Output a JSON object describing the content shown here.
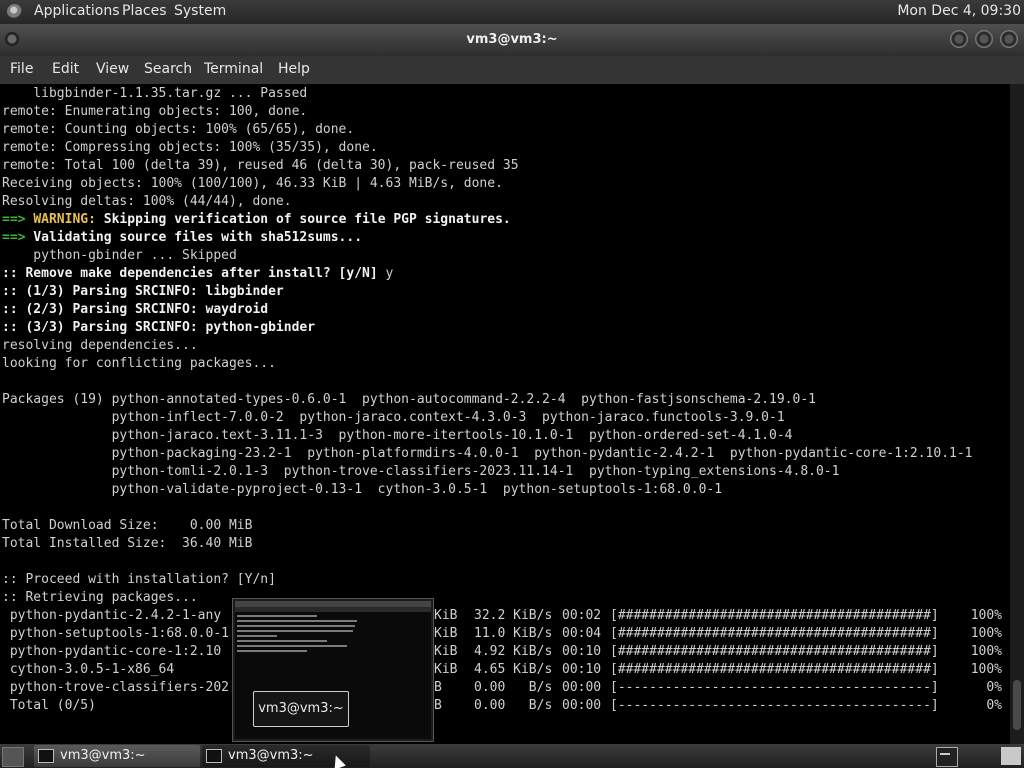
{
  "top_panel": {
    "menus": [
      "Applications",
      "Places",
      "System"
    ],
    "clock": "Mon Dec  4, 09:30"
  },
  "window": {
    "title": "vm3@vm3:~"
  },
  "menubar": [
    "File",
    "Edit",
    "View",
    "Search",
    "Terminal",
    "Help"
  ],
  "terminal": {
    "lines": [
      [
        {
          "t": "    libgbinder-1.1.35.tar.gz ... Passed"
        }
      ],
      [
        {
          "t": "remote: Enumerating objects: 100, done."
        }
      ],
      [
        {
          "t": "remote: Counting objects: 100% (65/65), done."
        }
      ],
      [
        {
          "t": "remote: Compressing objects: 100% (35/35), done."
        }
      ],
      [
        {
          "t": "remote: Total 100 (delta 39), reused 46 (delta 30), pack-reused 35"
        }
      ],
      [
        {
          "t": "Receiving objects: 100% (100/100), 46.33 KiB | 4.63 MiB/s, done."
        }
      ],
      [
        {
          "t": "Resolving deltas: 100% (44/44), done."
        }
      ],
      [
        {
          "t": "==> ",
          "c": "arrow"
        },
        {
          "t": "WARNING:",
          "c": "warn"
        },
        {
          "t": " Skipping verification of source file PGP signatures.",
          "c": "b"
        }
      ],
      [
        {
          "t": "==> ",
          "c": "arrow"
        },
        {
          "t": "Validating source files with sha512sums...",
          "c": "b"
        }
      ],
      [
        {
          "t": "    python-gbinder ... Skipped"
        }
      ],
      [
        {
          "t": ":: Remove make dependencies after install? [y/N]",
          "c": "b"
        },
        {
          "t": " y"
        }
      ],
      [
        {
          "t": ":: (1/3) Parsing SRCINFO: libgbinder",
          "c": "b"
        }
      ],
      [
        {
          "t": ":: (2/3) Parsing SRCINFO: waydroid",
          "c": "b"
        }
      ],
      [
        {
          "t": ":: (3/3) Parsing SRCINFO: python-gbinder",
          "c": "b"
        }
      ],
      [
        {
          "t": "resolving dependencies..."
        }
      ],
      [
        {
          "t": "looking for conflicting packages..."
        }
      ],
      [
        {
          "t": ""
        }
      ],
      [
        {
          "t": "Packages (19) python-annotated-types-0.6.0-1  python-autocommand-2.2.2-4  python-fastjsonschema-2.19.0-1"
        }
      ],
      [
        {
          "t": "              python-inflect-7.0.0-2  python-jaraco.context-4.3.0-3  python-jaraco.functools-3.9.0-1"
        }
      ],
      [
        {
          "t": "              python-jaraco.text-3.11.1-3  python-more-itertools-10.1.0-1  python-ordered-set-4.1.0-4"
        }
      ],
      [
        {
          "t": "              python-packaging-23.2-1  python-platformdirs-4.0.0-1  python-pydantic-2.4.2-1  python-pydantic-core-1:2.10.1-1"
        }
      ],
      [
        {
          "t": "              python-tomli-2.0.1-3  python-trove-classifiers-2023.11.14-1  python-typing_extensions-4.8.0-1"
        }
      ],
      [
        {
          "t": "              python-validate-pyproject-0.13-1  cython-3.0.5-1  python-setuptools-1:68.0.0-1"
        }
      ],
      [
        {
          "t": ""
        }
      ],
      [
        {
          "t": "Total Download Size:    0.00 MiB"
        }
      ],
      [
        {
          "t": "Total Installed Size:  36.40 MiB"
        }
      ],
      [
        {
          "t": ""
        }
      ],
      [
        {
          "t": ":: Proceed with installation? [Y/n]"
        }
      ],
      [
        {
          "t": ":: Retrieving packages..."
        }
      ]
    ],
    "downloads": [
      {
        "name": " python-pydantic-2.4.2-1-any",
        "size": "KiB",
        "rate": "32.2 KiB/s",
        "time": "00:02",
        "bar": "[########################################]",
        "pct": "100%"
      },
      {
        "name": " python-setuptools-1:68.0.0-1",
        "size": "KiB",
        "rate": "11.0 KiB/s",
        "time": "00:04",
        "bar": "[########################################]",
        "pct": "100%"
      },
      {
        "name": " python-pydantic-core-1:2.10",
        "size": "KiB",
        "rate": "4.92 KiB/s",
        "time": "00:10",
        "bar": "[########################################]",
        "pct": "100%"
      },
      {
        "name": " cython-3.0.5-1-x86_64",
        "size": "KiB",
        "rate": "4.65 KiB/s",
        "time": "00:10",
        "bar": "[########################################]",
        "pct": "100%"
      },
      {
        "name": " python-trove-classifiers-202",
        "size": "B",
        "rate": "0.00   B/s",
        "time": "00:00",
        "bar": "[----------------------------------------]",
        "pct": "0%"
      },
      {
        "name": " Total (0/5)",
        "size": "B",
        "rate": "0.00   B/s",
        "time": "00:00",
        "bar": "[----------------------------------------]",
        "pct": "0%"
      }
    ]
  },
  "switcher": {
    "label": "vm3@vm3:~"
  },
  "taskbar": {
    "items": [
      "vm3@vm3:~",
      "vm3@vm3:~"
    ]
  }
}
